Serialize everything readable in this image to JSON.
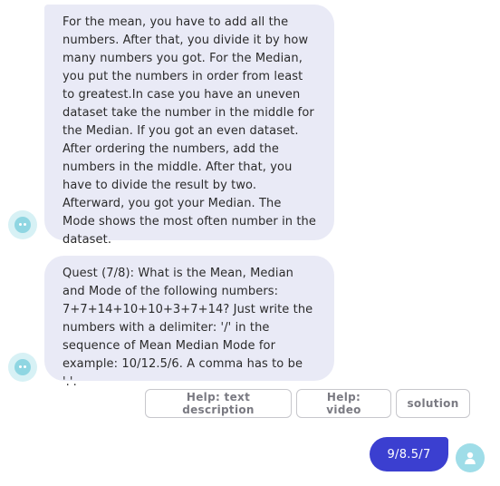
{
  "messages": [
    {
      "from": "bot",
      "text": "For the mean, you have to add all the numbers. After that, you divide it by how many numbers you got. For the Median, you put the numbers in order from least to greatest.In case you have an uneven dataset take the number in the middle for the Median. If you got an even dataset. After ordering the numbers, add the numbers in the middle. After that, you have to divide the result by two. Afterward, you got your Median. The Mode shows the most often number in the dataset."
    },
    {
      "from": "bot",
      "text": "Quest (7/8): What is the Mean, Median and Mode of the following numbers: 7+7+14+10+10+3+7+14? Just write the numbers with a delimiter: '/' in the sequence of Mean Median Mode for example: 10/12.5/6. A comma has to be '.'."
    }
  ],
  "help_buttons": {
    "text_description": "Help: text description",
    "video": "Help: video",
    "solution": "solution"
  },
  "user_reply": "9/8.5/7",
  "colors": {
    "bot_bubble": "#e9eaf6",
    "user_bubble": "#3b3fd0",
    "bot_avatar": "#8fd6e2",
    "user_avatar": "#9fdde8"
  },
  "icons": {
    "bot_avatar": "bot-face-icon",
    "user_avatar": "user-person-icon"
  }
}
